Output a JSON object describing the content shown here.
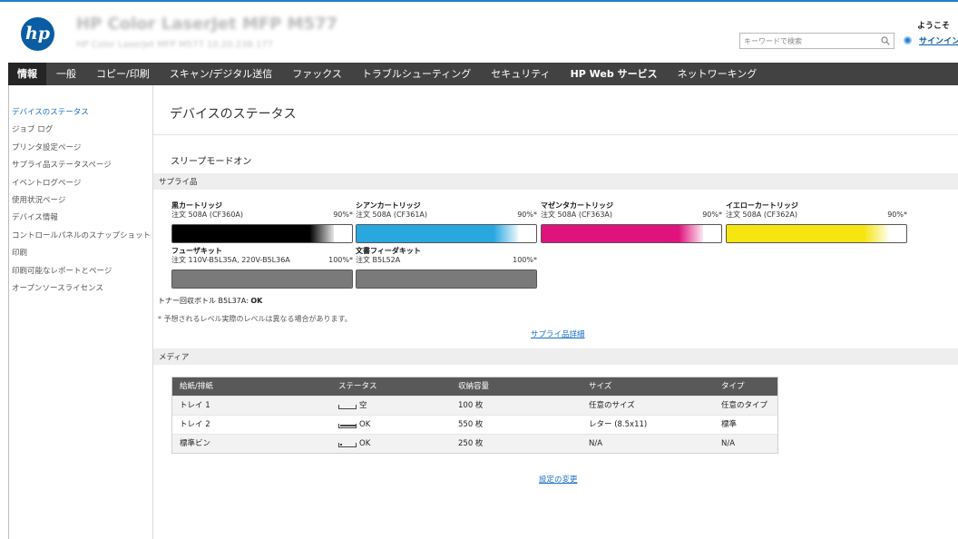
{
  "header": {
    "product_name": "HP Color LaserJet MFP M577",
    "product_subtitle": "HP Color LaserJet MFP M577   10.20.238.177",
    "search_placeholder": "キーワードで検索",
    "welcome": "ようこそ",
    "sign_in": "サインイン",
    "logo_text": "hp"
  },
  "nav": {
    "tabs": [
      "情報",
      "一般",
      "コピー/印刷",
      "スキャン/デジタル送信",
      "ファックス",
      "トラブルシューティング",
      "セキュリティ",
      "HP Web サービス",
      "ネットワーキング"
    ],
    "active_index": 0
  },
  "sidebar": {
    "items": [
      "デバイスのステータス",
      "ジョブ ログ",
      "プリンタ設定ページ",
      "サプライ品ステータスページ",
      "イベントログページ",
      "使用状況ページ",
      "デバイス情報",
      "コントロールパネルのスナップショット",
      "印刷",
      "印刷可能なレポートとページ",
      "オープンソースライセンス"
    ],
    "active_index": 0
  },
  "main": {
    "title": "デバイスのステータス",
    "status": "スリープモードオン",
    "supplies_section": "サプライ品",
    "supplies": [
      {
        "name": "黒カートリッジ",
        "order": "注文 508A (CF360A)",
        "percent": "90%*",
        "level": 0.9,
        "color": "#000000"
      },
      {
        "name": "シアンカートリッジ",
        "order": "注文 508A (CF361A)",
        "percent": "90%*",
        "level": 0.9,
        "color": "#29a8e0"
      },
      {
        "name": "マゼンタカートリッジ",
        "order": "注文 508A (CF363A)",
        "percent": "90%*",
        "level": 0.9,
        "color": "#e0127e"
      },
      {
        "name": "イエローカートリッジ",
        "order": "注文 508A (CF362A)",
        "percent": "90%*",
        "level": 0.9,
        "color": "#f5e511"
      },
      {
        "name": "フューザキット",
        "order": "注文 110V-B5L35A, 220V-B5L36A",
        "percent": "100%*",
        "level": 1.0,
        "color": "#7a7a7a"
      },
      {
        "name": "文書フィーダキット",
        "order": "注文 B5L52A",
        "percent": "100%*",
        "level": 1.0,
        "color": "#7a7a7a"
      }
    ],
    "toner_collection": {
      "label": "トナー回収ボトル B5L37A:",
      "status": "OK"
    },
    "note": "* 予想されるレベル実際のレベルは異なる場合があります。",
    "supply_details_link": "サプライ品詳細",
    "media_section": "メディア",
    "media_table": {
      "headers": [
        "給紙/排紙",
        "ステータス",
        "収納容量",
        "サイズ",
        "タイプ"
      ],
      "rows": [
        {
          "tray": "トレイ 1",
          "status": "空",
          "level": 0.0,
          "capacity": "100 枚",
          "size": "任意のサイズ",
          "type": "任意のタイプ"
        },
        {
          "tray": "トレイ 2",
          "status": "OK",
          "level": 1.0,
          "capacity": "550 枚",
          "size": "レター (8.5x11)",
          "type": "標準"
        },
        {
          "tray": "標準ビン",
          "status": "OK",
          "level": 0.1,
          "capacity": "250 枚",
          "size": "N/A",
          "type": "N/A"
        }
      ]
    },
    "change_settings_link": "設定の変更"
  }
}
